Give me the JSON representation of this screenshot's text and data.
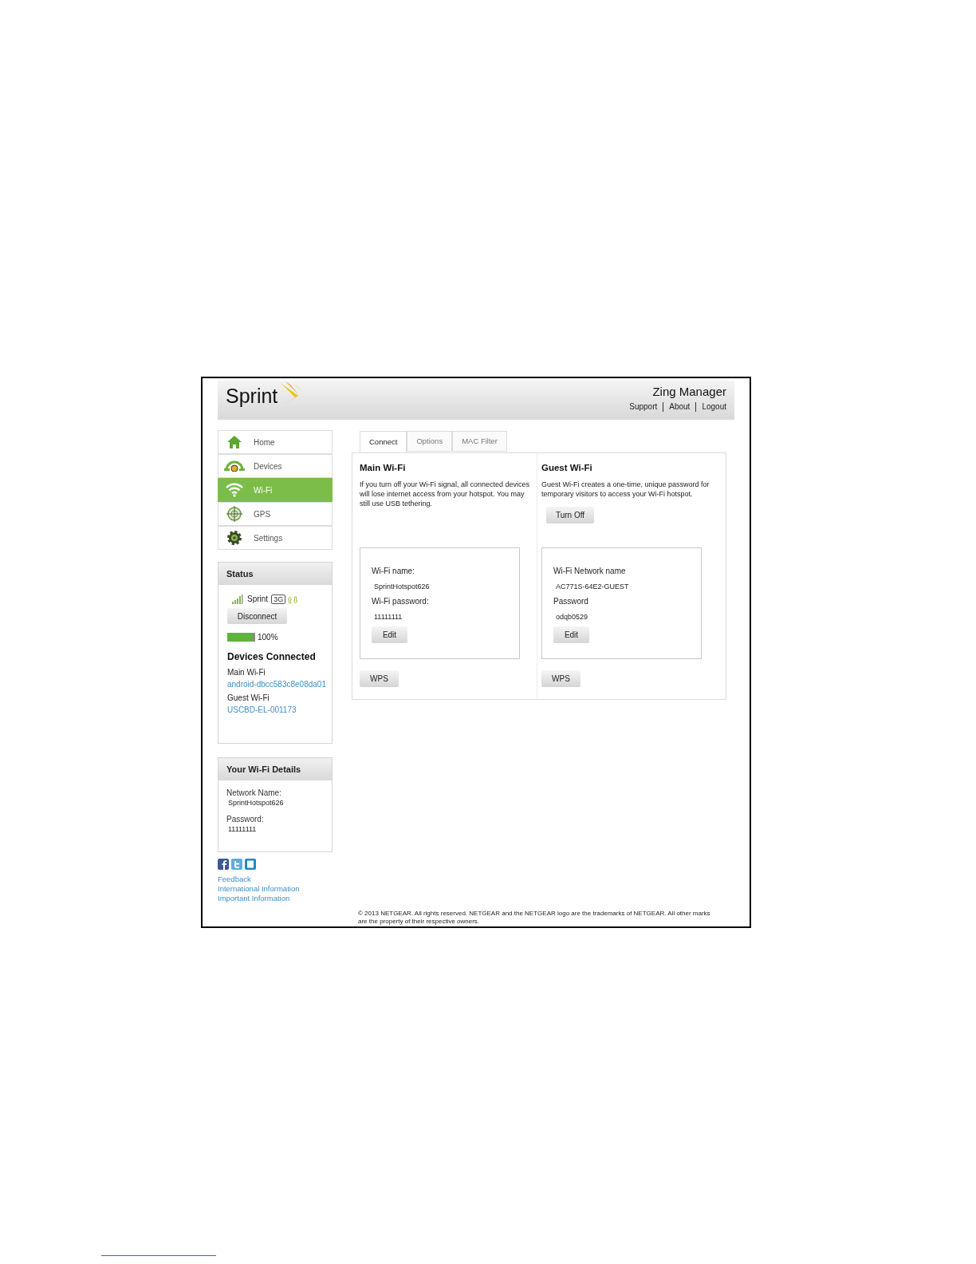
{
  "header": {
    "logo": "Sprint",
    "title": "Zing Manager",
    "links": [
      "Support",
      "About",
      "Logout"
    ]
  },
  "nav": [
    {
      "label": "Home",
      "kind": "home",
      "selected": false
    },
    {
      "label": "Devices",
      "kind": "devices",
      "selected": false
    },
    {
      "label": "Wi-Fi",
      "kind": "wifi",
      "selected": true
    },
    {
      "label": "GPS",
      "kind": "gps",
      "selected": false
    },
    {
      "label": "Settings",
      "kind": "settings",
      "selected": false
    }
  ],
  "status": {
    "title": "Status",
    "carrier": "Sprint",
    "network": "3G",
    "disconnect_button": "Disconnect",
    "battery": {
      "level": 1,
      "reading": "100%"
    },
    "devices_title": "Devices Connected",
    "groups": [
      {
        "label": "Main Wi-Fi",
        "device": "android-dbcc583c8e08da01"
      },
      {
        "label": "Guest Wi-Fi",
        "device": "USCBD-EL-001173"
      }
    ]
  },
  "wifi_details": {
    "title": "Your Wi-Fi Details",
    "network_name_label": "Network Name:",
    "network_name": "SprintHotspot626",
    "password_label": "Password:",
    "password": "11111111"
  },
  "links": [
    "Feedback",
    "International Information",
    "Important Information"
  ],
  "tabs": [
    {
      "label": "Connect",
      "selected": true
    },
    {
      "label": "Options",
      "selected": false
    },
    {
      "label": "MAC Filter",
      "selected": false
    }
  ],
  "sections": [
    {
      "title": "Main Wi-Fi",
      "description": "If you turn off your Wi-Fi signal, all connected devices will lose internet access from your hotspot. You may still use USB tethering.",
      "name_label": "Wi-Fi name:",
      "name": "SprintHotspot626",
      "password_label": "Wi-Fi password:",
      "password": "11111111",
      "edit_button": "Edit",
      "wps_button": "WPS"
    },
    {
      "title": "Guest Wi-Fi",
      "description": "Guest Wi-Fi creates a one-time, unique password for temporary visitors to access your Wi-Fi hotspot.",
      "turn_off_button": "Turn Off",
      "name_label": "Wi-Fi Network name",
      "name": "AC771S-64E2-GUEST",
      "password_label": "Password",
      "password": "odqb0529",
      "edit_button": "Edit",
      "wps_button": "WPS"
    }
  ],
  "copyright": "© 2013 NETGEAR. All rights reserved. NETGEAR and the NETGEAR logo are the trademarks of NETGEAR. All other marks are the property of their respective owners."
}
